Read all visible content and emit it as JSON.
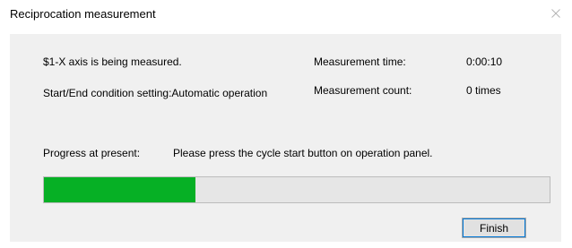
{
  "window": {
    "title": "Reciprocation measurement",
    "close_icon": "close-icon"
  },
  "status": {
    "axis_message": "$1-X axis is being measured.",
    "condition_setting": "Start/End condition setting:Automatic operation",
    "time_label": "Measurement time:",
    "time_value": "0:00:10",
    "count_label": "Measurement count:",
    "count_value": "0 times"
  },
  "progress": {
    "label": "Progress at present:",
    "message": "Please press the cycle start button on operation panel.",
    "fraction": 0.3,
    "fill_color": "#06b025",
    "track_color": "#e6e6e6"
  },
  "buttons": {
    "finish_label": "Finish"
  }
}
